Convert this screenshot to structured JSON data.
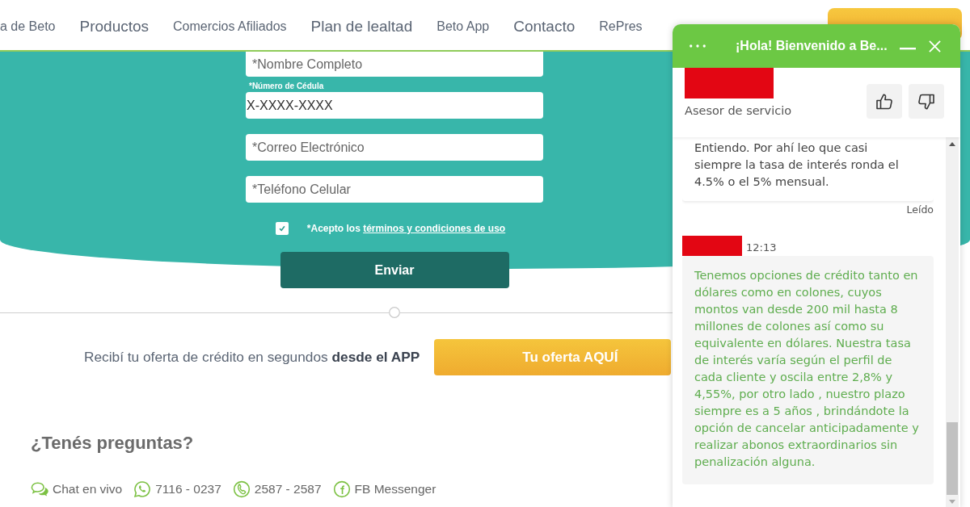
{
  "nav": {
    "items": [
      {
        "label": "a de Beto",
        "kind": "small"
      },
      {
        "label": "Productos",
        "kind": "large"
      },
      {
        "label": "Comercios Afiliados",
        "kind": "small"
      },
      {
        "label": "Plan de lealtad",
        "kind": "large"
      },
      {
        "label": "Beto App",
        "kind": "small"
      },
      {
        "label": "Contacto",
        "kind": "large"
      },
      {
        "label": "RePres",
        "kind": "small"
      }
    ]
  },
  "form": {
    "fields": [
      {
        "placeholder": "*Nombre Completo"
      },
      {
        "label": "*Número de Cédula",
        "value": "X-XXXX-XXXX"
      },
      {
        "placeholder": "*Correo Electrónico"
      },
      {
        "placeholder": "*Teléfono Celular"
      }
    ],
    "terms": {
      "checked": true,
      "text": "*Acepto los",
      "link": "términos y condiciones de uso"
    },
    "submit": "Enviar"
  },
  "offer": {
    "text": "Recibí tu oferta de crédito en segundos **desde el APP**",
    "button": "Tu oferta AQUÍ"
  },
  "questions": {
    "title": "¿Tenés preguntas?",
    "contacts": [
      {
        "kind": "chat",
        "label": "Chat en vivo"
      },
      {
        "kind": "whatsapp",
        "label": "7116 - 0237"
      },
      {
        "kind": "phone",
        "label": "2587 - 2587"
      },
      {
        "kind": "facebook",
        "label": "FB Messenger"
      }
    ]
  },
  "chat": {
    "title": "¡Hola! Bienvenido a Be...",
    "agent_role": "Asesor de servicio",
    "messages": [
      {
        "kind": "user",
        "text": "Entiendo. Por ahí leo que casi siempre la tasa de interés ronda el 4.5% o el 5% mensual.",
        "status": "Leído"
      },
      {
        "kind": "agent",
        "time": "12:13",
        "text": "Tenemos opciones de crédito tanto en dólares como en colones, cuyos montos van desde 200 mil hasta 8 millones de colones así como su equivalente en dólares. Nuestra tasa de interés varía según el perfil de cada cliente y oscila entre 2,8% y 4,55%, por otro lado , nuestro plazo siempre es a 5 años , brindándote la opción de cancelar anticipadamente y realizar abonos extraordinarios sin penalización alguna."
      }
    ]
  }
}
